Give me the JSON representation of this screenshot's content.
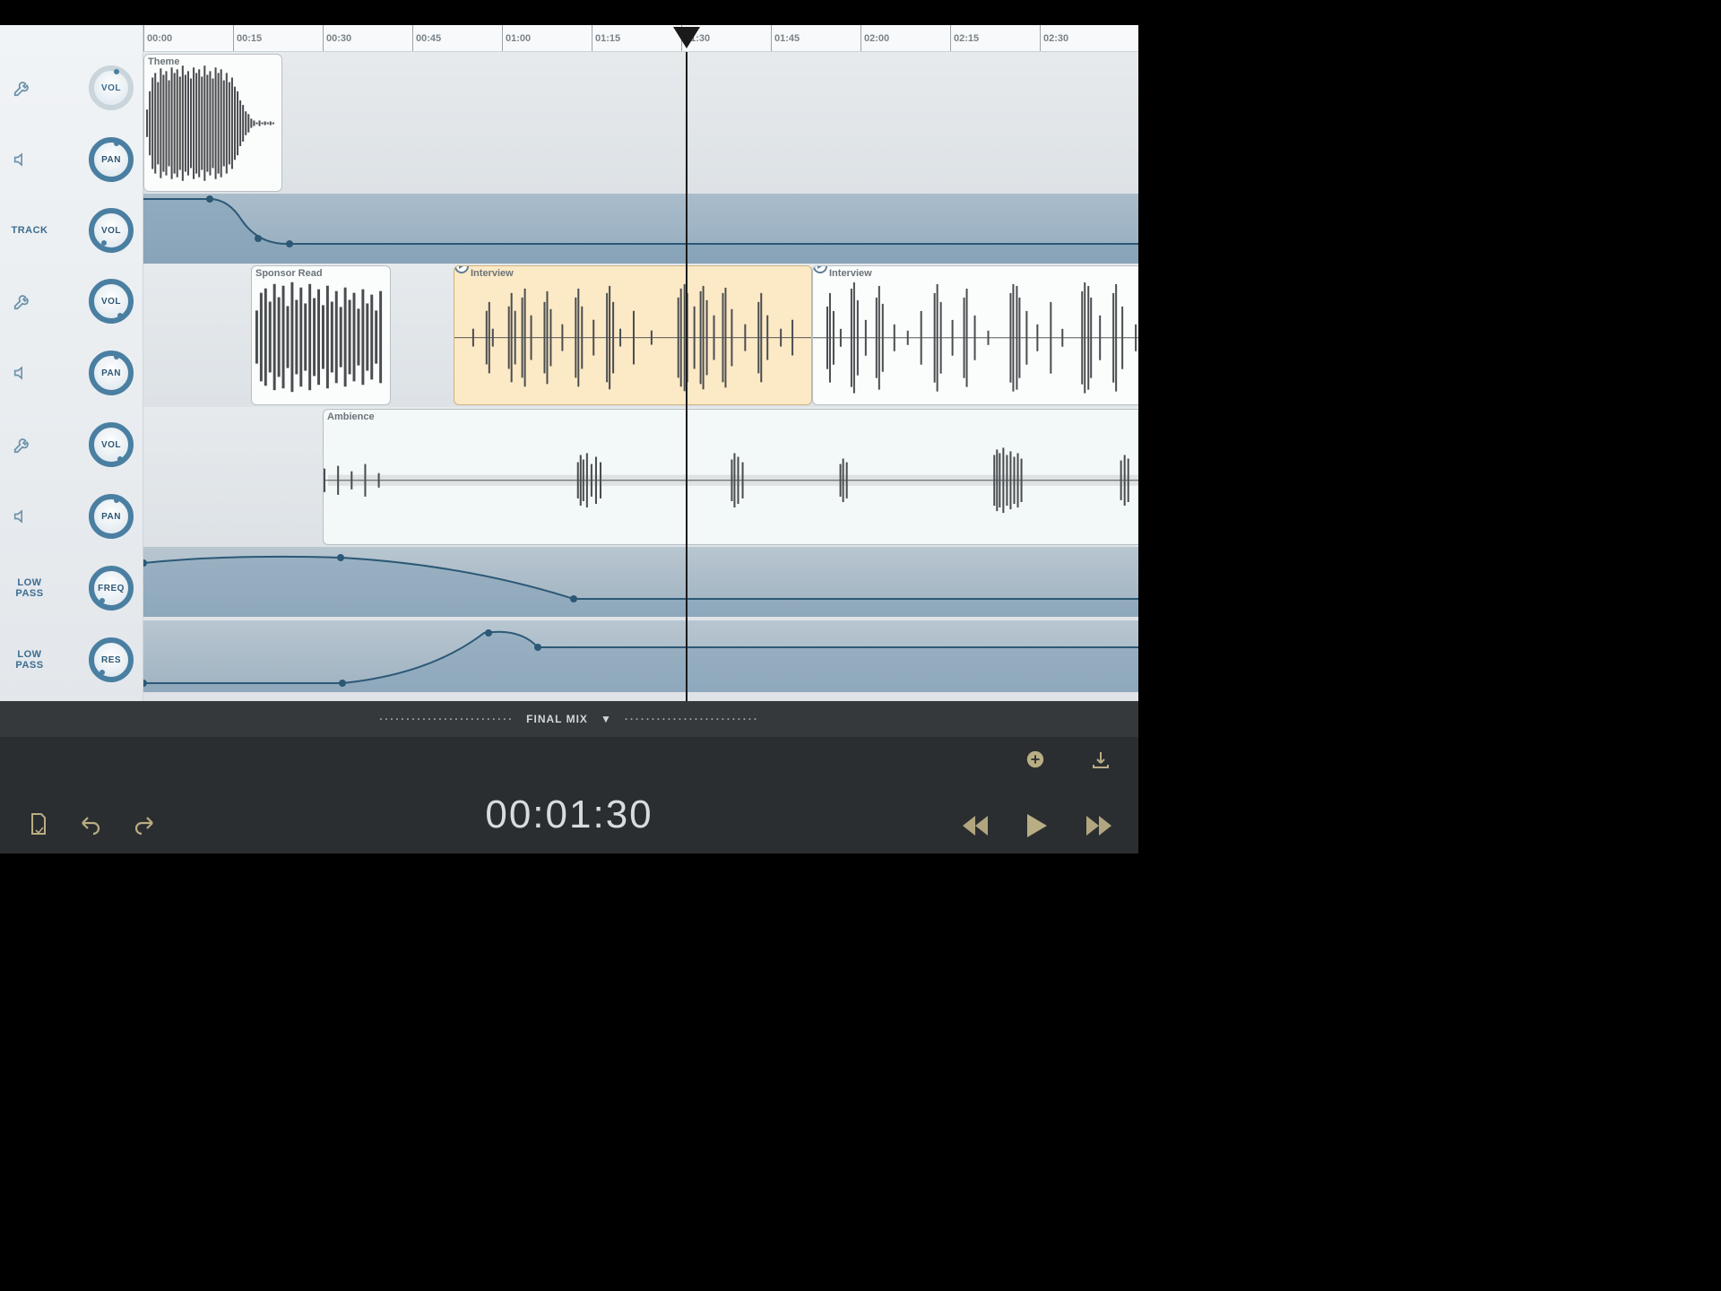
{
  "ruler": {
    "ticks": [
      "00:00",
      "00:15",
      "00:30",
      "00:45",
      "01:00",
      "01:15",
      "01:30",
      "01:45",
      "02:00",
      "02:15",
      "02:30"
    ],
    "pixelsPerTick": 100
  },
  "sidebar": {
    "trackLabel": "TRACK",
    "lowPassLabel": "LOW PASS",
    "knobs": {
      "vol": "VOL",
      "pan": "PAN",
      "freq": "FREQ",
      "res": "RES"
    }
  },
  "clips": {
    "theme": "Theme",
    "sponsorRead": "Sponsor Read",
    "interview": "Interview",
    "ambience": "Ambience"
  },
  "mixBar": {
    "label": "FINAL MIX"
  },
  "transport": {
    "time": "00:01:30"
  },
  "playheadPositionPx": 605,
  "colors": {
    "accent": "#4a7fa2",
    "gold": "#c9bb8e"
  }
}
